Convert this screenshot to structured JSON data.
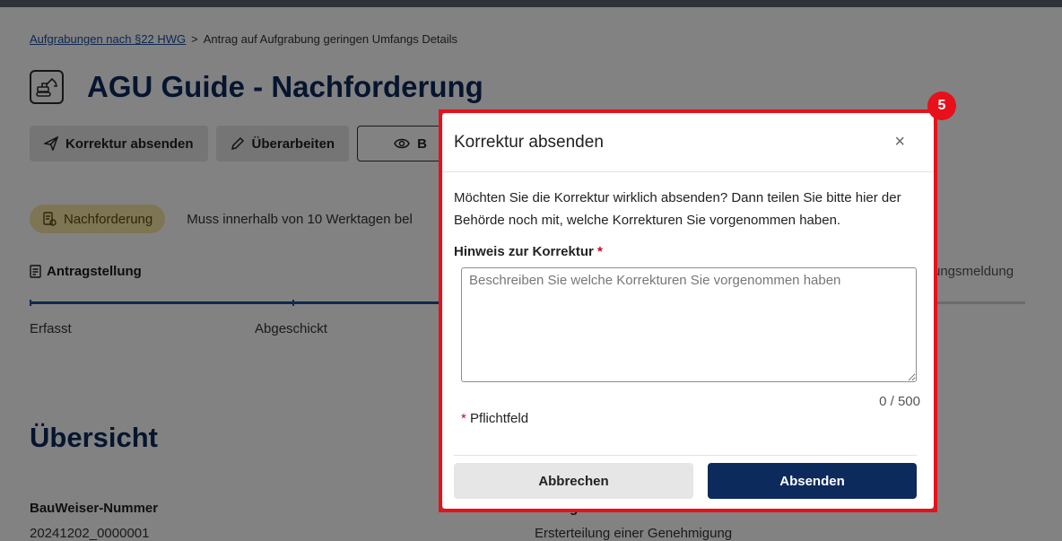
{
  "breadcrumb": {
    "link": "Aufgrabungen nach §22 HWG",
    "separator": ">",
    "current": "Antrag auf Aufgrabung geringen Umfangs Details"
  },
  "page": {
    "title": "AGU Guide - Nachforderung"
  },
  "toolbar": {
    "correction_label": "Korrektur absenden",
    "edit_label": "Überarbeiten",
    "view_label": "B"
  },
  "status": {
    "badge": "Nachforderung",
    "text": "Muss innerhalb von 10 Werktagen bel"
  },
  "steps": {
    "title": "Antragstellung",
    "right_label": "ungsmeldung",
    "items": [
      "Erfasst",
      "Abgeschickt"
    ]
  },
  "overview": {
    "heading": "Übersicht",
    "fields": [
      {
        "label": "BauWeiser-Nummer",
        "value": "20241202_0000001"
      },
      {
        "label": "Antragsart",
        "value": "Ersterteilung einer Genehmigung"
      }
    ]
  },
  "modal": {
    "title": "Korrektur absenden",
    "close": "×",
    "message": "Möchten Sie die Korrektur wirklich absenden? Dann teilen Sie bitte hier der Behörde noch mit, welche Korrekturen Sie vorgenommen haben.",
    "field_label": "Hinweis zur Korrektur",
    "required_mark": "*",
    "placeholder": "Beschreiben Sie welche Korrekturen Sie vorgenommen haben",
    "counter": "0 / 500",
    "required_note": "Pflichtfeld",
    "cancel_label": "Abbrechen",
    "submit_label": "Absenden"
  },
  "annotation": {
    "step_number": "5"
  },
  "colors": {
    "brand_navy": "#0d2a5c",
    "link_blue": "#1f4fa0",
    "highlight_red": "#e8101a",
    "badge_yellow": "#f5e6a3"
  }
}
